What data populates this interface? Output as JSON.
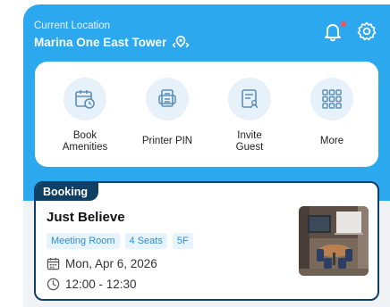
{
  "header": {
    "location_label": "Current Location",
    "location_name": "Marina One East Tower",
    "notification_dot_color": "#ff4d5a",
    "bg_color": "#2ba8ee"
  },
  "quick_actions": [
    {
      "label": "Book\nAmenities",
      "icon": "calendar-clock-icon"
    },
    {
      "label": "Printer PIN",
      "icon": "printer-icon"
    },
    {
      "label": "Invite\nGuest",
      "icon": "guest-badge-icon"
    },
    {
      "label": "More",
      "icon": "grid-icon"
    }
  ],
  "booking": {
    "tag": "Booking",
    "title": "Just Believe",
    "chips": [
      "Meeting Room",
      "4 Seats",
      "5F"
    ],
    "date": "Mon, Apr 6, 2026",
    "time": "12:00 - 12:30",
    "accent_color": "#0f3f63"
  }
}
